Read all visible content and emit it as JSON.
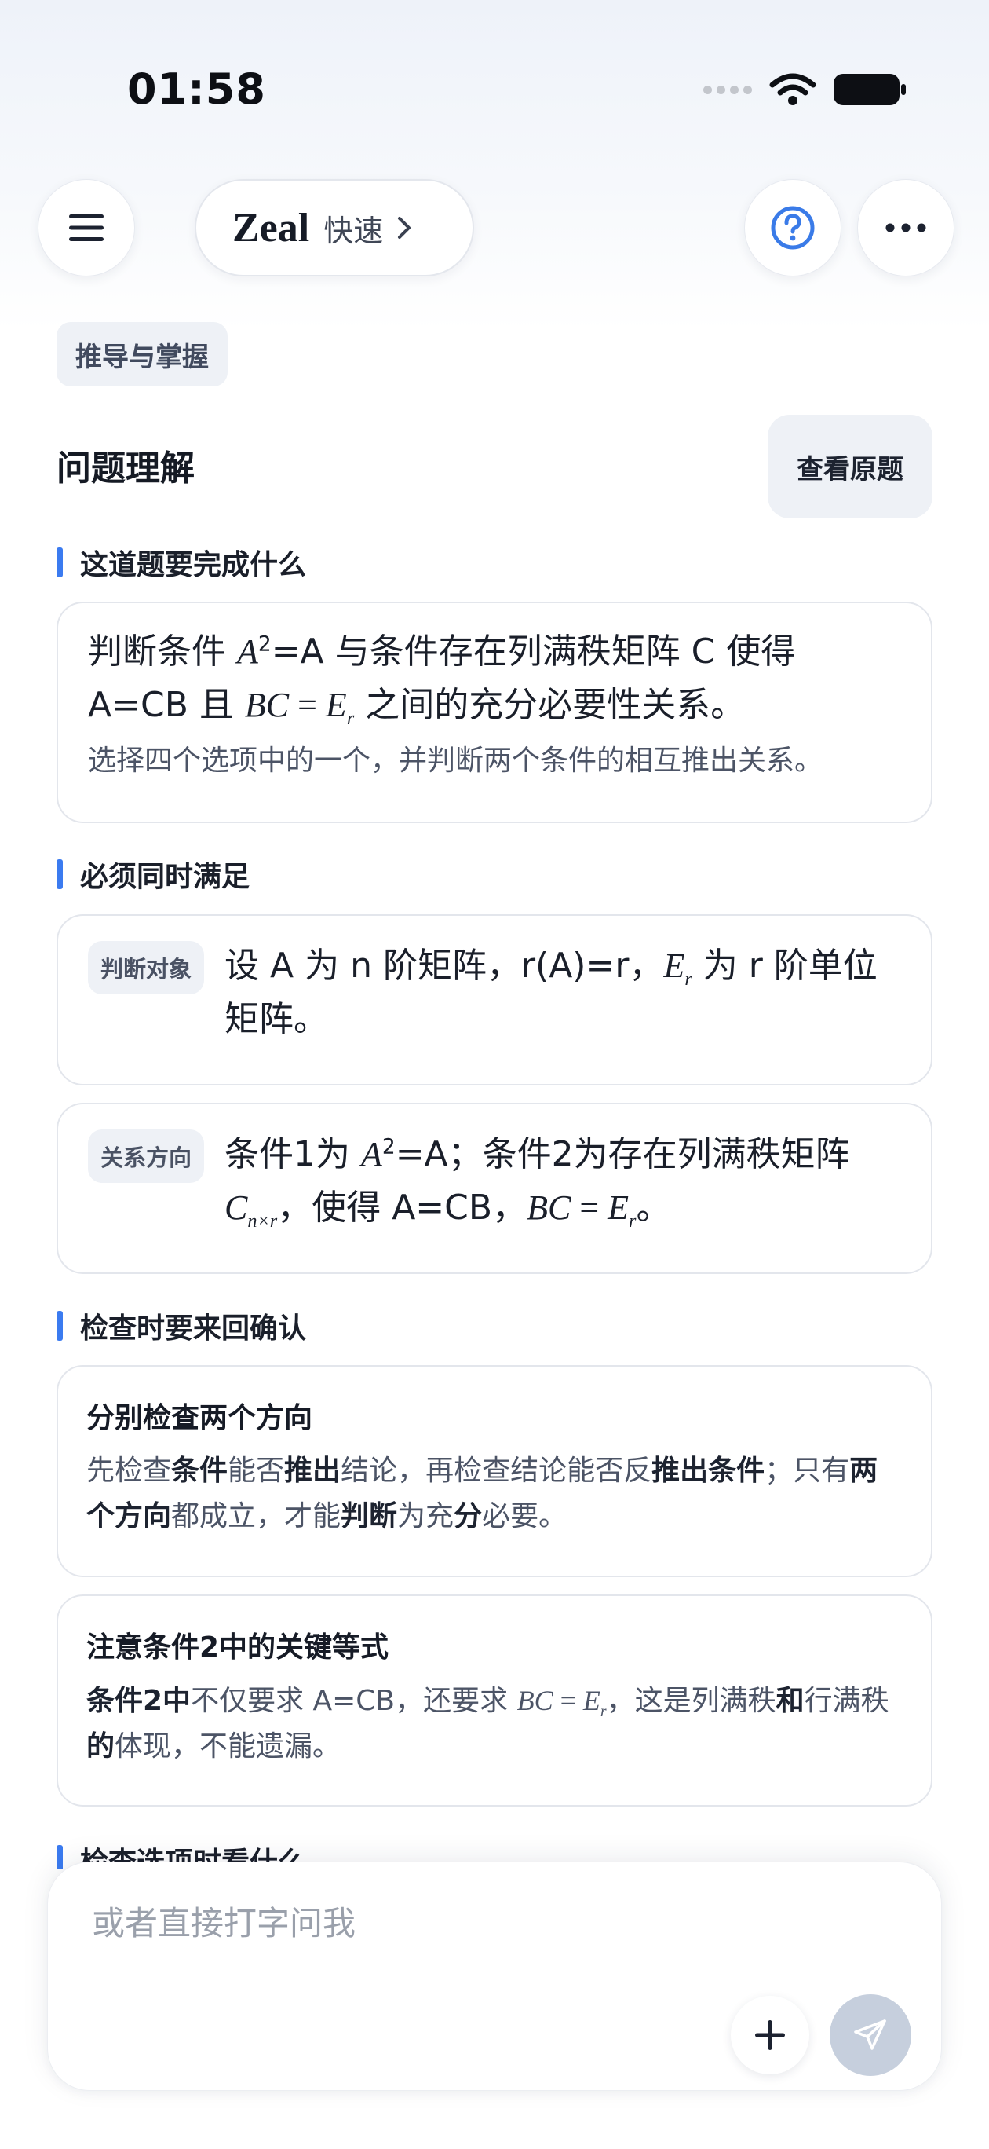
{
  "status": {
    "time": "01:58"
  },
  "header": {
    "model_name": "Zeal",
    "model_speed": "快速"
  },
  "tag": "推导与掌握",
  "section": {
    "title": "问题理解",
    "view_original": "查看原题"
  },
  "headings": {
    "goal": "这道题要完成什么",
    "must": "必须同时满足",
    "check": "检查时要来回确认",
    "options": "检查选项时看什么"
  },
  "goal_card": {
    "p1": "判断条件 ",
    "p2": "=A 与条件存在列满秩矩阵 C 使得 A=CB 且 ",
    "p3": " 之间的充分必要性关系。",
    "note": "选择四个选项中的一个，并判断两个条件的相互推出关系。"
  },
  "conditions": [
    {
      "chip": "判断对象",
      "t1": "设 A 为 n 阶矩阵，r(A)=r，",
      "t2": " 为 r 阶单位矩阵。"
    },
    {
      "chip": "关系方向",
      "t1": "条件1为 ",
      "t2": "=A；条件2为存在列满秩矩阵 ",
      "t3": "，使得 A=CB，",
      "t4": "。"
    }
  ],
  "tips": [
    {
      "title": "分别检查两个方向",
      "b1": "先检查",
      "b2": "条件",
      "b3": "能否",
      "b4": "推出",
      "b5": "结论，再检查结论能否反",
      "b6": "推出条件",
      "b7": "；只有",
      "b8": "两个方向",
      "b9": "都成立，才能",
      "b10": "判断",
      "b11": "为充",
      "b12": "分",
      "b13": "必要。"
    },
    {
      "title": "注意条件2中的关键等式",
      "b1": "条件2中",
      "b2": "不仅要求 A=CB，还要求 ",
      "b3": "，这是列满秩",
      "b4": "和",
      "b5": "行满秩",
      "b6": "的",
      "b7": "体现，不能遗漏。"
    }
  ],
  "math": {
    "A": "A",
    "two": "2",
    "BC": "BC",
    "eq": " = ",
    "E": "E",
    "r": "r",
    "C": "C",
    "nxr": "n×r"
  },
  "input": {
    "placeholder": "或者直接打字问我"
  },
  "icons": {
    "menu": "menu-icon",
    "chevron": "chevron-right-icon",
    "help": "help-icon",
    "more": "more-icon",
    "wifi": "wifi-icon",
    "battery": "battery-icon",
    "plus": "plus-icon",
    "send": "send-icon"
  },
  "colors": {
    "accent": "#3b7bf0",
    "help": "#3a7be8",
    "send_bg": "#c6cfdd"
  }
}
